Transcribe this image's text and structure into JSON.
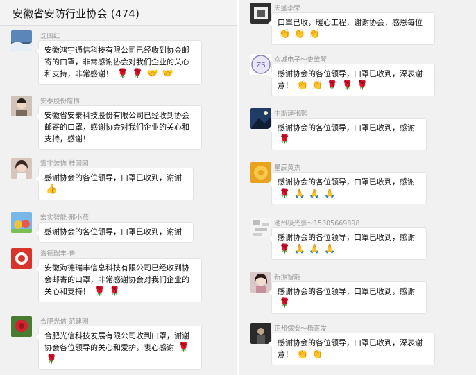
{
  "window": {
    "group_title": "安徽省安防行业协会 (474)"
  },
  "left_messages": [
    {
      "sender": "沈国红",
      "text": "安徽鸿宇通信科技有限公司已经收到协会邮寄的口罩，非常感谢协会对我们企业的关心和支持，非常感谢！"
    },
    {
      "sender": "安泰股份詹梅",
      "text": "安徽省安泰科技股份有限公司已经收到协会邮寄的口罩，感谢协会对我们企业的关心和支持，感谢！"
    },
    {
      "sender": "寰宇装饰 桂园园",
      "text": "感谢协会的各位领导，口罩已收到，谢谢"
    },
    {
      "sender": "宏实智能-邢小燕",
      "text": "感谢协会的各位领导，口罩已收到，谢谢"
    },
    {
      "sender": "海德瑞丰-鲁",
      "text": "安徽海德瑞丰信息科技有限公司已经收到协会邮寄的口罩，非常感谢协会对我们企业的关心和支持！"
    },
    {
      "sender": "合肥光信 范建刚",
      "text": "合肥光信科技发展有限公司收到口罩，谢谢协会各位领导的关心和爱护，衷心感谢"
    }
  ],
  "right_messages": [
    {
      "sender": "天盛李荣",
      "text": "口罩已收，暖心工程，谢谢协会，感恩每位"
    },
    {
      "sender": "众城电子～史维琴",
      "text": "感谢协会的各位领导，口罩已收到，深表谢意！"
    },
    {
      "sender": "中勘建张鹏",
      "text": "感谢协会的各位领导，口罩已收到，感谢"
    },
    {
      "sender": "星辰黄杰",
      "text": "感谢协会的各位领导，口罩已收到，感谢"
    },
    {
      "sender": "池州极光张～15305669898",
      "text": "感谢协会的各位领导，口罩已收到，感谢"
    },
    {
      "sender": "新振智能",
      "text": "感谢协会的各位领导，口罩已收到，感谢"
    },
    {
      "sender": "正邦保安～杨正发",
      "text": "感谢协会的各位领导，口罩已收到，深表谢意！"
    }
  ],
  "emoji": {
    "rose": "🌹",
    "handshake": "🤝",
    "pray": "🙏",
    "clap": "👏",
    "thumb": "👍"
  },
  "colors": {
    "rose": "#d7262b",
    "hands": "#e7a93c",
    "bubble_bg": "#ffffff",
    "panel_bg": "#f1f1f1",
    "sender_text": "#9a9a9a"
  }
}
